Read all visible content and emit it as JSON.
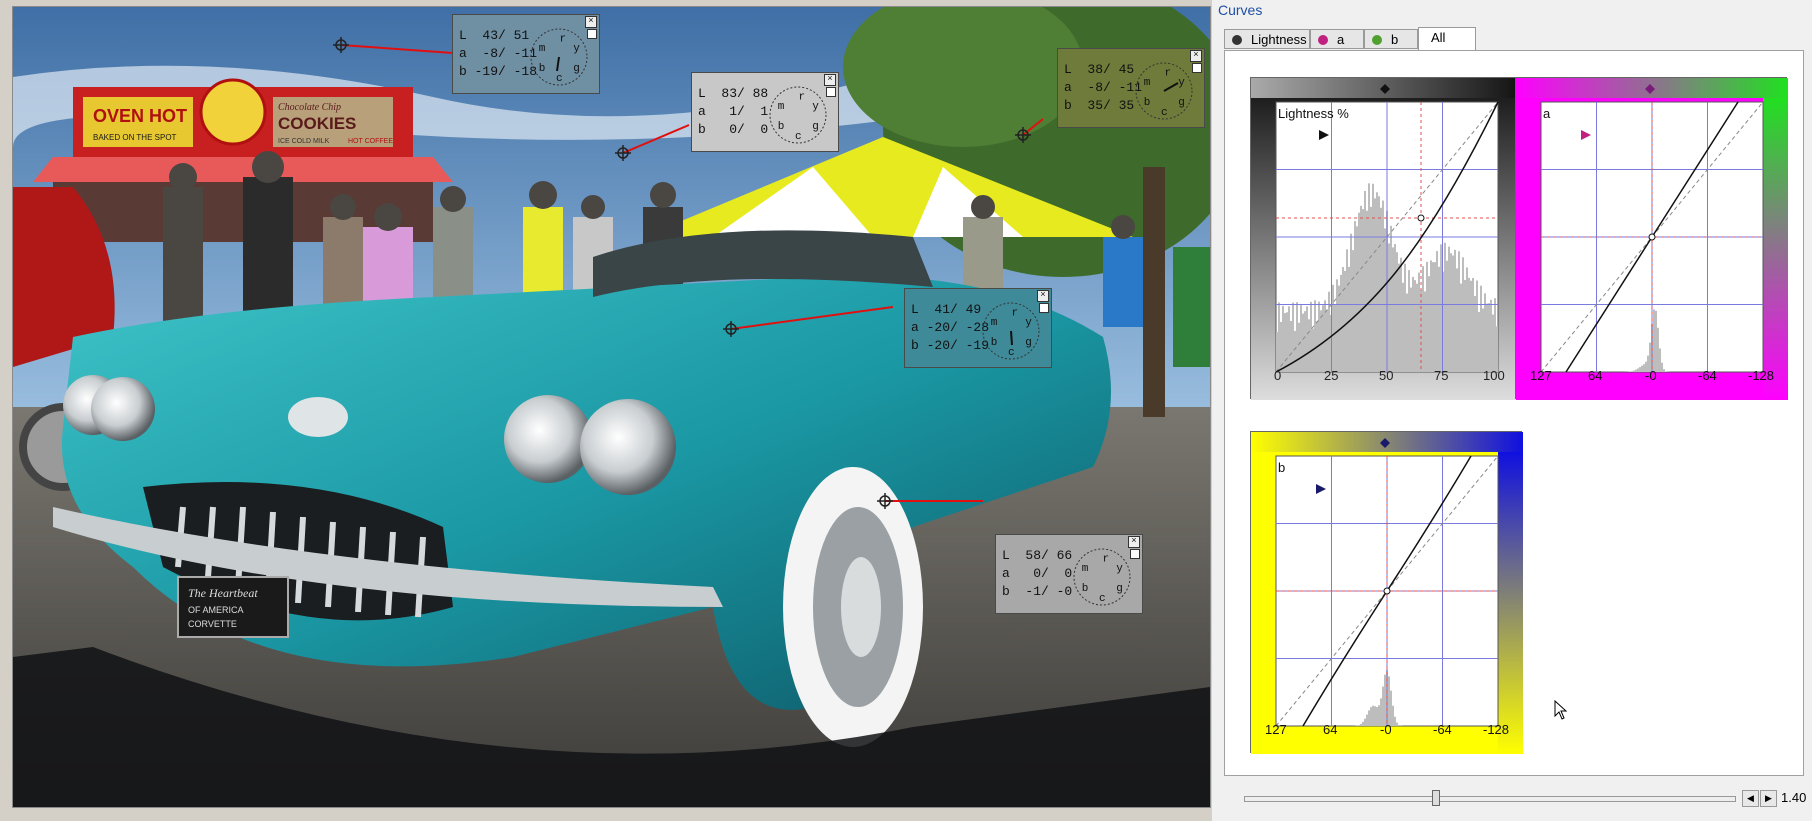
{
  "panel": {
    "title": "Curves"
  },
  "tabs": [
    {
      "label": "Lightness",
      "dot": "#333333"
    },
    {
      "label": "a",
      "dot": "#c02080"
    },
    {
      "label": "b",
      "dot": "#50a030"
    },
    {
      "label": "All",
      "active": true
    }
  ],
  "readouts": [
    {
      "rows": [
        "L  43/ 51",
        "a  -8/ -11",
        "b -19/ -18"
      ],
      "bg": "#6f8fa3"
    },
    {
      "rows": [
        "L  83/ 88",
        "a   1/  1",
        "b   0/  0"
      ],
      "bg": "#c8c8c8"
    },
    {
      "rows": [
        "L  38/ 45",
        "a  -8/ -11",
        "b  35/ 35"
      ],
      "bg": "#6f7b3a"
    },
    {
      "rows": [
        "L  41/ 49",
        "a -20/ -28",
        "b -20/ -19"
      ],
      "bg": "#3f8a98"
    },
    {
      "rows": [
        "L  58/ 66",
        "a   0/  0",
        "b  -1/ -0"
      ],
      "bg": "#a8a8a8"
    }
  ],
  "dial_letters": [
    "r",
    "y",
    "g",
    "c",
    "b",
    "m"
  ],
  "curves": {
    "lightness": {
      "label": "Lightness %",
      "ticks": [
        "0",
        "25",
        "50",
        "75",
        "100"
      ]
    },
    "a": {
      "label": "a",
      "ticks": [
        "127",
        "64",
        "-0",
        "-64",
        "-128"
      ]
    },
    "b": {
      "label": "b",
      "ticks": [
        "127",
        "64",
        "-0",
        "-64",
        "-128"
      ]
    }
  },
  "photo": {
    "signs": [
      "OVEN HOT",
      "BAKED ON THE SPOT",
      "COOKIES",
      "Chocolate Chip",
      "ICE COLD MILK",
      "HOT COFFEE"
    ],
    "plate": [
      "The Heartbeat",
      "OF AMERICA",
      "CORVETTE"
    ]
  },
  "slider": {
    "value": "1.40"
  },
  "colors": {
    "accent": "#1f4fa3",
    "marker_line": "#e01010"
  }
}
